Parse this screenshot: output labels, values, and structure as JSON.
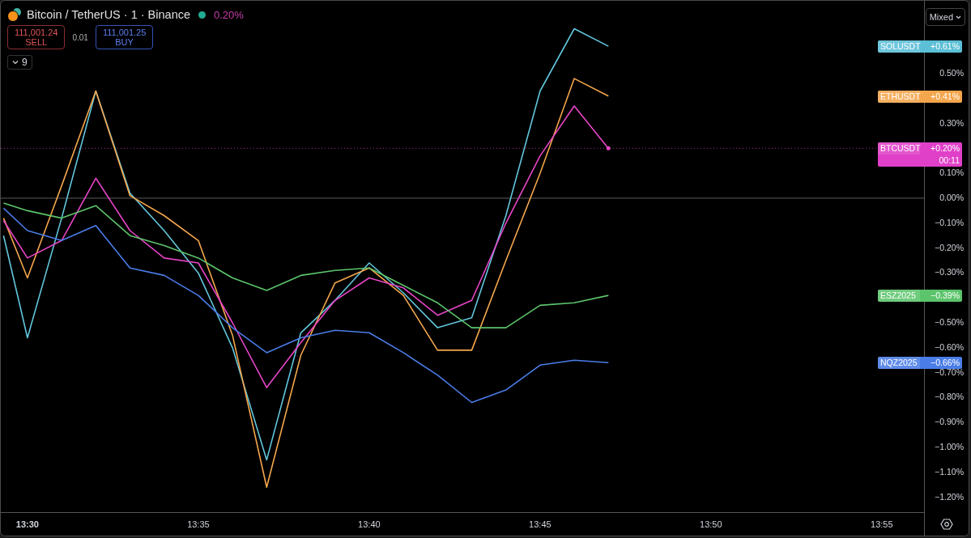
{
  "legend": {
    "title": "Bitcoin / TetherUS · 1 · Binance",
    "market_open": true,
    "change": "0.20%"
  },
  "trade": {
    "sell_price": "111,001.24",
    "sell_label": "SELL",
    "spread": "0.01",
    "buy_price": "111,001.25",
    "buy_label": "BUY"
  },
  "indicators_toggle": {
    "count": "9"
  },
  "scale_mode": "Mixed",
  "chart": {
    "chart_data": {
      "type": "line",
      "x": [
        809.3,
        810,
        811,
        812,
        813,
        814,
        815,
        816,
        817,
        818,
        819,
        820,
        821,
        822,
        823,
        824,
        825,
        826,
        827
      ],
      "series": [
        {
          "name": "SOLUSDT",
          "color": "#62c6dc",
          "values": [
            -0.15,
            -0.56,
            -0.08,
            0.43,
            0.02,
            -0.13,
            -0.3,
            -0.6,
            -1.05,
            -0.54,
            -0.41,
            -0.26,
            -0.38,
            -0.52,
            -0.48,
            -0.07,
            0.43,
            0.68,
            0.61
          ]
        },
        {
          "name": "ETHUSDT",
          "color": "#f4a64c",
          "values": [
            -0.08,
            -0.32,
            0.05,
            0.43,
            0.01,
            -0.07,
            -0.17,
            -0.55,
            -1.16,
            -0.63,
            -0.34,
            -0.28,
            -0.39,
            -0.61,
            -0.61,
            -0.25,
            0.1,
            0.48,
            0.41
          ]
        },
        {
          "name": "BTCUSDT",
          "color": "#e845c8",
          "values": [
            -0.09,
            -0.24,
            -0.17,
            0.08,
            -0.13,
            -0.24,
            -0.26,
            -0.5,
            -0.76,
            -0.58,
            -0.41,
            -0.32,
            -0.36,
            -0.47,
            -0.41,
            -0.1,
            0.17,
            0.37,
            0.2
          ]
        },
        {
          "name": "ESZ2025",
          "color": "#5cc46b",
          "values": [
            -0.02,
            -0.05,
            -0.08,
            -0.03,
            -0.15,
            -0.19,
            -0.24,
            -0.32,
            -0.37,
            -0.31,
            -0.29,
            -0.28,
            -0.35,
            -0.42,
            -0.52,
            -0.52,
            -0.43,
            -0.42,
            -0.39
          ]
        },
        {
          "name": "NQZ2025",
          "color": "#4a7de8",
          "values": [
            -0.04,
            -0.13,
            -0.17,
            -0.11,
            -0.28,
            -0.31,
            -0.39,
            -0.52,
            -0.62,
            -0.56,
            -0.53,
            -0.54,
            -0.62,
            -0.71,
            -0.82,
            -0.77,
            -0.67,
            -0.65,
            -0.66
          ]
        }
      ],
      "xlim": [
        809.22,
        836.26
      ],
      "ylim": [
        -1.263,
        0.792
      ],
      "xticks": [
        {
          "value": 810,
          "label": "13:30"
        },
        {
          "value": 815,
          "label": "13:35"
        },
        {
          "value": 820,
          "label": "13:40"
        },
        {
          "value": 825,
          "label": "13:45"
        },
        {
          "value": 830,
          "label": "13:50"
        },
        {
          "value": 835,
          "label": "13:55"
        }
      ],
      "yticks": [
        {
          "value": 0.5,
          "label": "0.50%"
        },
        {
          "value": 0.3,
          "label": "0.30%"
        },
        {
          "value": 0.1,
          "label": "0.10%"
        },
        {
          "value": 0,
          "label": "0.00%"
        },
        {
          "value": -0.1,
          "label": "−0.10%"
        },
        {
          "value": -0.2,
          "label": "−0.20%"
        },
        {
          "value": -0.3,
          "label": "−0.30%"
        },
        {
          "value": -0.5,
          "label": "−0.50%"
        },
        {
          "value": -0.6,
          "label": "−0.60%"
        },
        {
          "value": -0.7,
          "label": "−0.70%"
        },
        {
          "value": -0.8,
          "label": "−0.80%"
        },
        {
          "value": -0.9,
          "label": "−0.90%"
        },
        {
          "value": -1.0,
          "label": "−1.00%"
        },
        {
          "value": -1.1,
          "label": "−1.10%"
        },
        {
          "value": -1.2,
          "label": "−1.20%"
        }
      ]
    }
  },
  "price_tags": [
    {
      "change": "+0.61%",
      "color": "#5bbfd6"
    },
    {
      "change": "+0.41%",
      "color": "#f4a64c"
    },
    {
      "change": "+0.20%",
      "countdown": "00:11",
      "color": "#e040c8"
    },
    {
      "change": "−0.39%",
      "color": "#5cc46b"
    },
    {
      "change": "−0.66%",
      "color": "#4a7de8"
    }
  ]
}
